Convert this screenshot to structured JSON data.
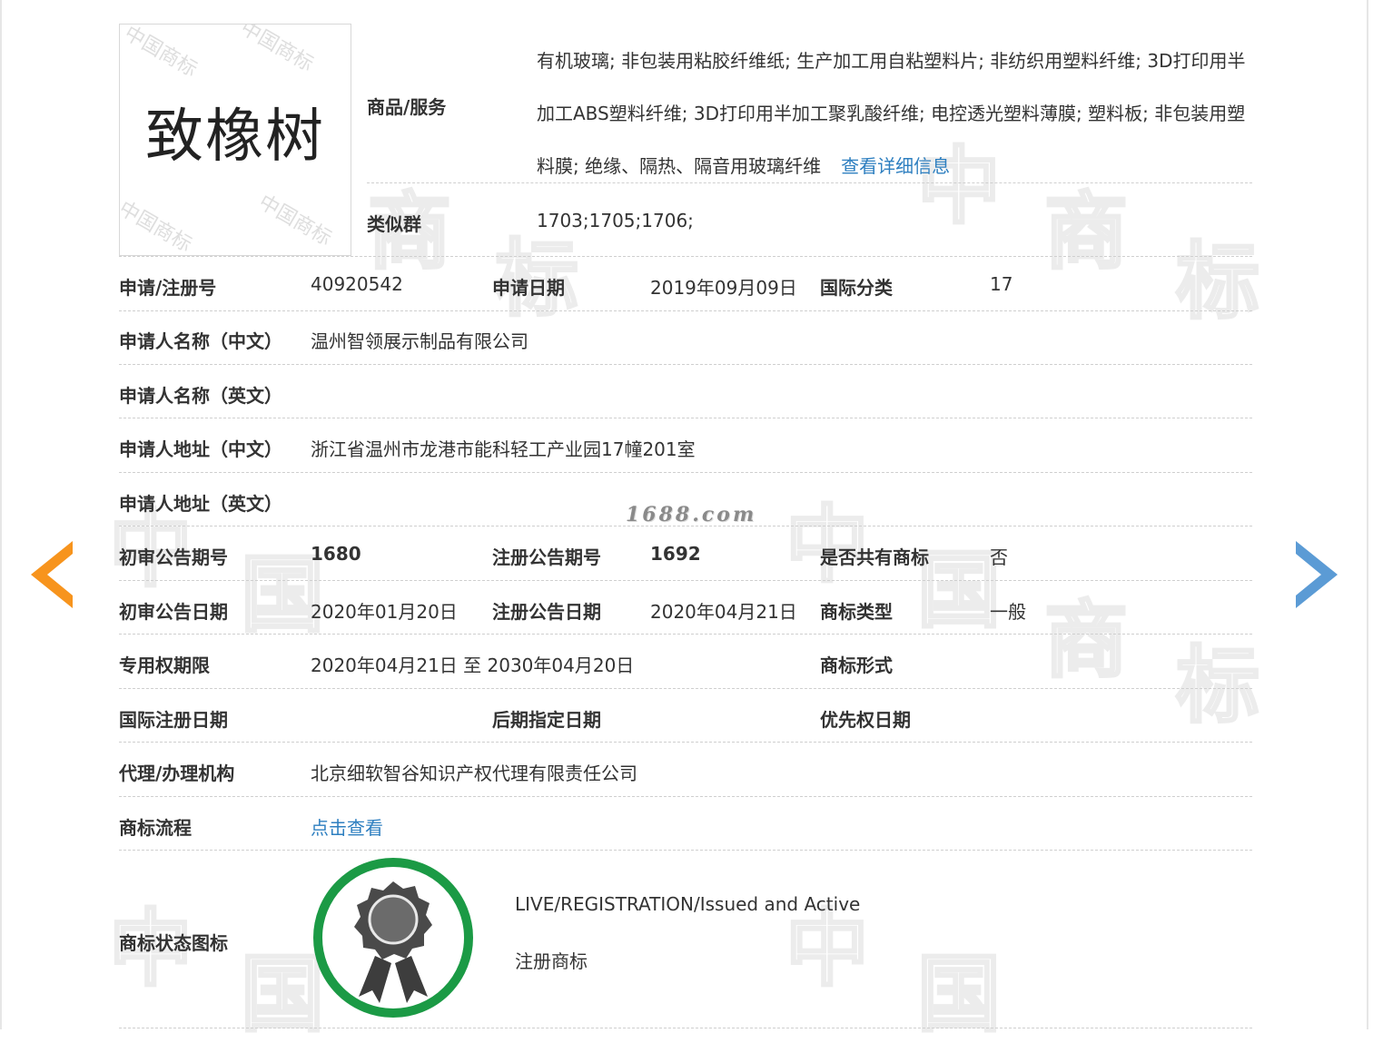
{
  "trademark": {
    "image_text": "致橡树",
    "image_watermark": "中国商标"
  },
  "goods_services": {
    "label": "商品/服务",
    "text": "有机玻璃; 非包装用粘胶纤维纸; 生产加工用自粘塑料片; 非纺织用塑料纤维; 3D打印用半加工ABS塑料纤维; 3D打印用半加工聚乳酸纤维; 电控透光塑料薄膜; 塑料板; 非包装用塑料膜; 绝缘、隔热、隔音用玻璃纤维",
    "detail_link": "查看详细信息"
  },
  "similar_group": {
    "label": "类似群",
    "value": "1703;1705;1706;"
  },
  "application": {
    "number_label": "申请/注册号",
    "number": "40920542",
    "date_label": "申请日期",
    "date": "2019年09月09日",
    "class_label": "国际分类",
    "class": "17"
  },
  "applicant": {
    "name_cn_label": "申请人名称（中文）",
    "name_cn": "温州智领展示制品有限公司",
    "name_en_label": "申请人名称（英文）",
    "name_en": "",
    "addr_cn_label": "申请人地址（中文）",
    "addr_cn": "浙江省温州市龙港市能科轻工产业园17幢201室",
    "addr_en_label": "申请人地址（英文）",
    "addr_en": ""
  },
  "announcement": {
    "prelim_no_label": "初审公告期号",
    "prelim_no": "1680",
    "reg_no_label": "注册公告期号",
    "reg_no": "1692",
    "shared_label": "是否共有商标",
    "shared": "否",
    "prelim_date_label": "初审公告日期",
    "prelim_date": "2020年01月20日",
    "reg_date_label": "注册公告日期",
    "reg_date": "2020年04月21日",
    "type_label": "商标类型",
    "type": "一般"
  },
  "rights": {
    "period_label": "专用权期限",
    "period": "2020年04月21日 至 2030年04月20日",
    "form_label": "商标形式",
    "form": ""
  },
  "dates": {
    "intl_label": "国际注册日期",
    "intl": "",
    "later_label": "后期指定日期",
    "later": "",
    "priority_label": "优先权日期",
    "priority": ""
  },
  "agent": {
    "label": "代理/办理机构",
    "value": "北京细软智谷知识产权代理有限责任公司"
  },
  "process": {
    "label": "商标流程",
    "link": "点击查看"
  },
  "status": {
    "label": "商标状态图标",
    "en": "LIVE/REGISTRATION/Issued and Active",
    "cn": "注册商标",
    "badge_ring_color": "#1b9a45",
    "badge_icon": "award-rosette-icon"
  },
  "site_watermark": "1688.com",
  "navigation": {
    "prev_icon": "chevron-left-icon",
    "prev_color": "#f7941d",
    "next_icon": "chevron-right-icon",
    "next_color": "#5b9bd5"
  },
  "background_watermark": [
    "中",
    "国",
    "商",
    "标",
    "商",
    "标",
    "中",
    "国",
    "商",
    "标",
    "中",
    "国"
  ]
}
